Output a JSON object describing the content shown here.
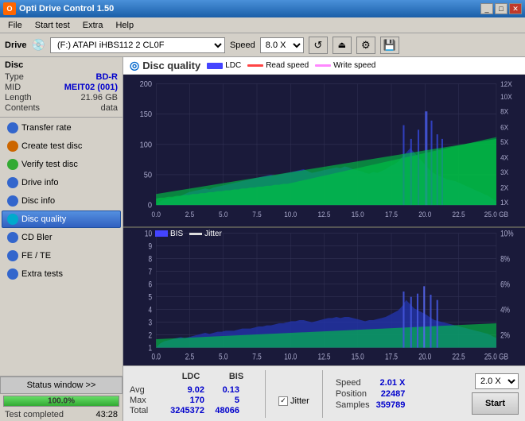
{
  "titleBar": {
    "title": "Opti Drive Control 1.50",
    "icon": "O"
  },
  "menuBar": {
    "items": [
      "File",
      "Start test",
      "Extra",
      "Help"
    ]
  },
  "driveBar": {
    "driveLabel": "Drive",
    "driveValue": "(F:)  ATAPI iHBS112  2 CL0F",
    "speedLabel": "Speed",
    "speedValue": "8.0 X"
  },
  "disc": {
    "title": "Disc",
    "type": {
      "key": "Type",
      "val": "BD-R"
    },
    "mid": {
      "key": "MID",
      "val": "MEIT02 (001)"
    },
    "length": {
      "key": "Length",
      "val": "21.96 GB"
    },
    "contents": {
      "key": "Contents",
      "val": "data"
    }
  },
  "nav": {
    "items": [
      {
        "id": "transfer-rate",
        "label": "Transfer rate",
        "iconType": "blue"
      },
      {
        "id": "create-test-disc",
        "label": "Create test disc",
        "iconType": "orange"
      },
      {
        "id": "verify-test-disc",
        "label": "Verify test disc",
        "iconType": "green"
      },
      {
        "id": "drive-info",
        "label": "Drive info",
        "iconType": "blue"
      },
      {
        "id": "disc-info",
        "label": "Disc info",
        "iconType": "blue"
      },
      {
        "id": "disc-quality",
        "label": "Disc quality",
        "iconType": "cyan",
        "active": true
      },
      {
        "id": "cd-bler",
        "label": "CD Bler",
        "iconType": "blue"
      },
      {
        "id": "fe-te",
        "label": "FE / TE",
        "iconType": "blue"
      },
      {
        "id": "extra-tests",
        "label": "Extra tests",
        "iconType": "blue"
      }
    ]
  },
  "statusWindow": "Status window >>",
  "progressPercent": 100,
  "progressText": "100.0%",
  "statusText": "Test completed",
  "timeText": "43:28",
  "chartHeader": {
    "title": "Disc quality",
    "legend": [
      {
        "id": "ldc",
        "label": "LDC",
        "color": "#4444ff"
      },
      {
        "id": "read-speed",
        "label": "Read speed",
        "color": "#ff4444"
      },
      {
        "id": "write-speed",
        "label": "Write speed",
        "color": "#ff88ff"
      }
    ]
  },
  "upperChart": {
    "yMax": 200,
    "yMin": 0,
    "yLabels": [
      "200",
      "150",
      "100",
      "50",
      "0"
    ],
    "yRightLabels": [
      "12X",
      "10X",
      "8X",
      "6X",
      "5X",
      "4X",
      "3X",
      "2X",
      "1X"
    ],
    "xLabels": [
      "0.0",
      "2.5",
      "5.0",
      "7.5",
      "10.0",
      "12.5",
      "15.0",
      "17.5",
      "20.0",
      "22.5",
      "25.0 GB"
    ]
  },
  "lowerChart": {
    "legendItems": [
      {
        "id": "bis",
        "label": "BIS",
        "color": "#4444ff"
      },
      {
        "id": "jitter",
        "label": "Jitter",
        "color": "#dddddd"
      }
    ],
    "yMax": 10,
    "yMin": 1,
    "yLabels": [
      "10",
      "9",
      "8",
      "7",
      "6",
      "5",
      "4",
      "3",
      "2",
      "1"
    ],
    "yRightLabels": [
      "10%",
      "8%",
      "6%",
      "4%",
      "2%"
    ],
    "xLabels": [
      "0.0",
      "2.5",
      "5.0",
      "7.5",
      "10.0",
      "12.5",
      "15.0",
      "17.5",
      "20.0",
      "22.5",
      "25.0 GB"
    ]
  },
  "stats": {
    "ldcHeader": "LDC",
    "bisHeader": "BIS",
    "avgLabel": "Avg",
    "maxLabel": "Max",
    "totalLabel": "Total",
    "ldcAvg": "9.02",
    "ldcMax": "170",
    "ldcTotal": "3245372",
    "bisAvg": "0.13",
    "bisMax": "5",
    "bisTotal": "48066",
    "jitterChecked": true,
    "jitterLabel": "Jitter",
    "speedLabel": "Speed",
    "speedVal": "2.01 X",
    "positionLabel": "Position",
    "positionVal": "22487",
    "samplesLabel": "Samples",
    "samplesVal": "359789",
    "startLabel": "Start",
    "speedDropdown": "2.0 X"
  }
}
